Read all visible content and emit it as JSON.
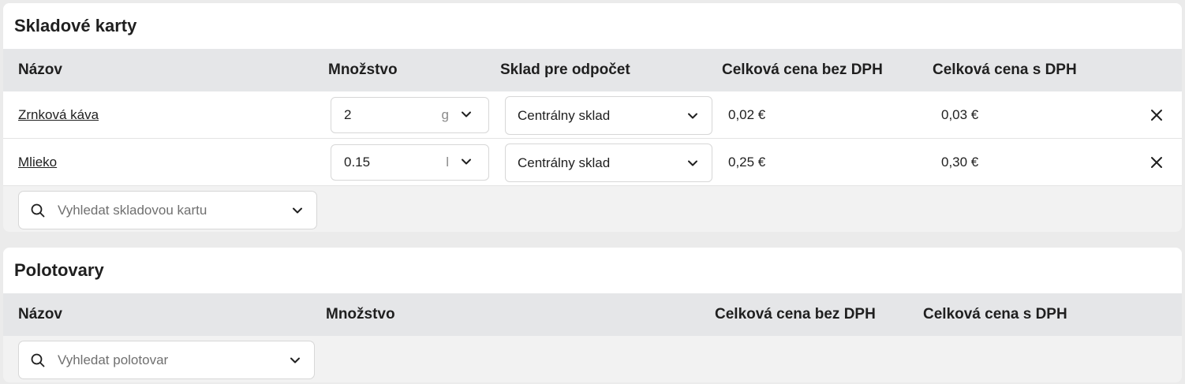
{
  "stock_cards": {
    "title": "Skladové karty",
    "columns": {
      "name": "Názov",
      "quantity": "Množstvo",
      "warehouse": "Sklad pre odpočet",
      "price_excl_vat": "Celková cena bez DPH",
      "price_incl_vat": "Celková cena s DPH"
    },
    "rows": [
      {
        "name": "Zrnková káva",
        "quantity": "2",
        "unit": "g",
        "warehouse": "Centrálny sklad",
        "price_excl_vat": "0,02 €",
        "price_incl_vat": "0,03 €"
      },
      {
        "name": "Mlieko",
        "quantity": "0.15",
        "unit": "l",
        "warehouse": "Centrálny sklad",
        "price_excl_vat": "0,25 €",
        "price_incl_vat": "0,30 €"
      }
    ],
    "search_placeholder": "Vyhledat skladovou kartu"
  },
  "semi_products": {
    "title": "Polotovary",
    "columns": {
      "name": "Názov",
      "quantity": "Množstvo",
      "price_excl_vat": "Celková cena bez DPH",
      "price_incl_vat": "Celková cena s DPH"
    },
    "search_placeholder": "Vyhledat polotovar"
  },
  "icons": {
    "search": "search-icon",
    "chevron": "chevron-down-icon",
    "remove": "close-icon"
  }
}
